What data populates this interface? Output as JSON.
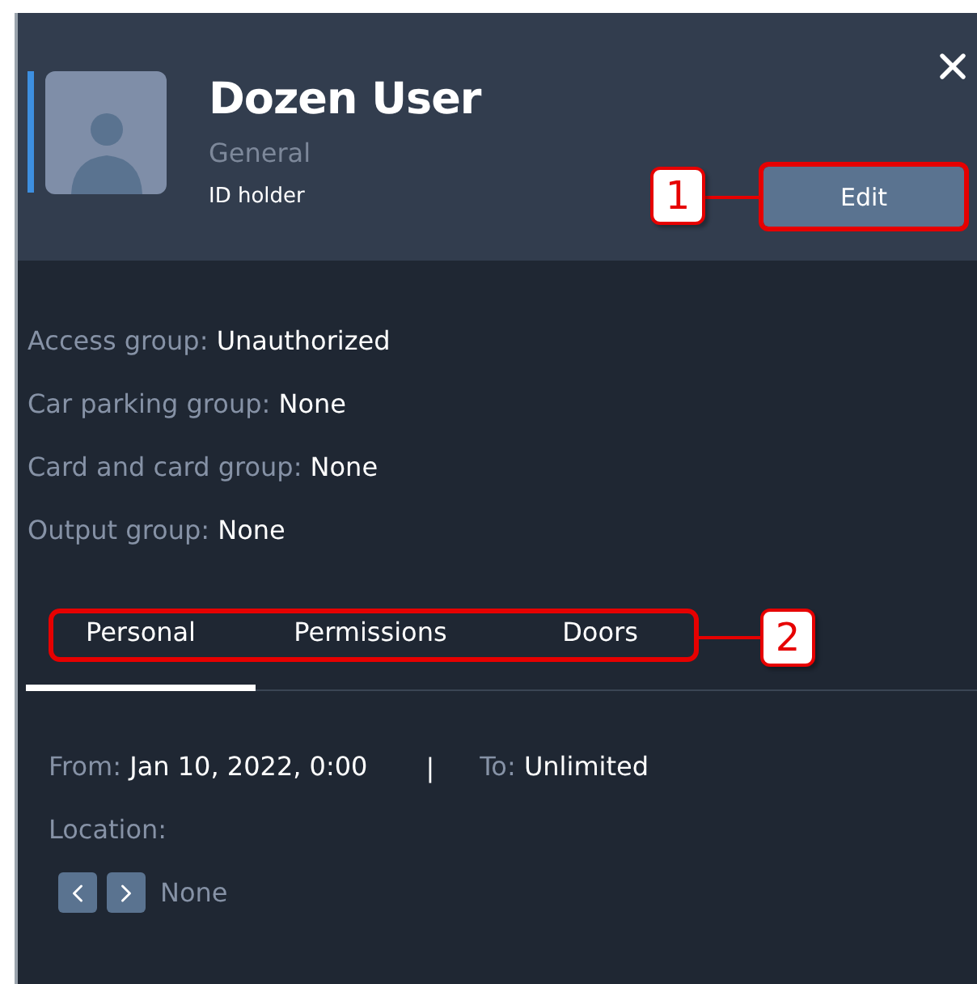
{
  "header": {
    "name": "Dozen User",
    "group": "General",
    "role": "ID holder",
    "edit_button": "Edit",
    "edit_callout": "1"
  },
  "fields": [
    {
      "label": "Access group:",
      "value": "Unauthorized"
    },
    {
      "label": "Car parking group:",
      "value": "None"
    },
    {
      "label": "Card and card group:",
      "value": "None"
    },
    {
      "label": "Output group:",
      "value": "None"
    }
  ],
  "tabs": [
    {
      "label": "Personal",
      "selected": true
    },
    {
      "label": "Permissions",
      "selected": false
    },
    {
      "label": "Doors",
      "selected": false
    }
  ],
  "tabs_callout": "2",
  "period": {
    "from_label": "From:",
    "from_value": "Jan 10, 2022, 0:00",
    "separator": "|",
    "to_label": "To:",
    "to_value": "Unlimited"
  },
  "location": {
    "label": "Location:",
    "value": "None"
  }
}
